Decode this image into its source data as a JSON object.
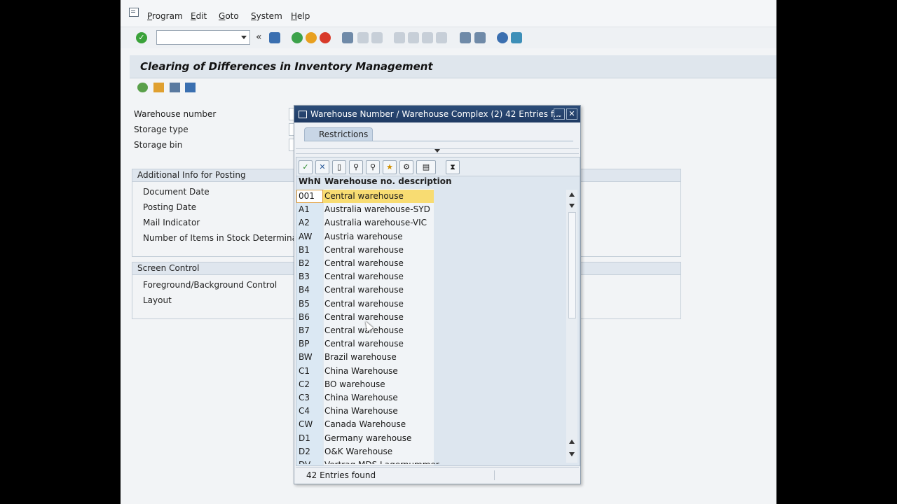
{
  "menu": [
    "Program",
    "Edit",
    "Goto",
    "System",
    "Help"
  ],
  "menu_underline": [
    "P",
    "E",
    "G",
    "S",
    "H"
  ],
  "menu_rest": [
    "rogram",
    "dit",
    "oto",
    "ystem",
    "elp"
  ],
  "page_title": "Clearing of Differences in Inventory Management",
  "fields": {
    "warehouse_number": "Warehouse number",
    "storage_type": "Storage type",
    "storage_bin": "Storage bin"
  },
  "group_posting": {
    "title": "Additional Info for Posting",
    "document_date": "Document Date",
    "posting_date": "Posting Date",
    "mail_indicator": "Mail Indicator",
    "items_stock": "Number of Items in Stock Determination"
  },
  "group_screen": {
    "title": "Screen Control",
    "fg_bg": "Foreground/Background Control",
    "layout": "Layout"
  },
  "popup": {
    "title": "Warehouse Number / Warehouse Complex (2)   42 Entries f...",
    "tab": "Restrictions",
    "col_key": "WhN",
    "col_desc": "Warehouse no. description",
    "status": "42 Entries found",
    "rows": [
      {
        "k": "001",
        "d": "Central warehouse"
      },
      {
        "k": "A1",
        "d": "Australia warehouse-SYD"
      },
      {
        "k": "A2",
        "d": "Australia warehouse-VIC"
      },
      {
        "k": "AW",
        "d": "Austria warehouse"
      },
      {
        "k": "B1",
        "d": "Central warehouse"
      },
      {
        "k": "B2",
        "d": "Central warehouse"
      },
      {
        "k": "B3",
        "d": "Central warehouse"
      },
      {
        "k": "B4",
        "d": "Central warehouse"
      },
      {
        "k": "B5",
        "d": "Central warehouse"
      },
      {
        "k": "B6",
        "d": "Central warehouse"
      },
      {
        "k": "B7",
        "d": "Central warehouse"
      },
      {
        "k": "BP",
        "d": "Central warehouse"
      },
      {
        "k": "BW",
        "d": "Brazil warehouse"
      },
      {
        "k": "C1",
        "d": "China Warehouse"
      },
      {
        "k": "C2",
        "d": "BO warehouse"
      },
      {
        "k": "C3",
        "d": "China Warehouse"
      },
      {
        "k": "C4",
        "d": "China Warehouse"
      },
      {
        "k": "CW",
        "d": "Canada Warehouse"
      },
      {
        "k": "D1",
        "d": "Germany warehouse"
      },
      {
        "k": "D2",
        "d": "O&K Warehouse"
      },
      {
        "k": "DV",
        "d": "Vertrag MDS Lagernummer"
      }
    ]
  },
  "colors": {
    "title_bar": "#1f3a63",
    "selection": "#f8dc72",
    "ok_green": "#3aa23a"
  }
}
